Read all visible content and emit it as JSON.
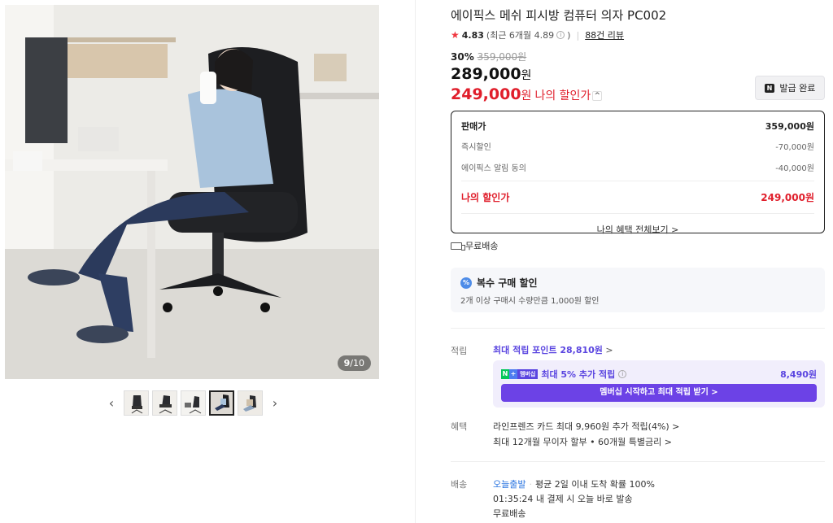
{
  "gallery": {
    "counter_current": "9",
    "counter_total": "/10",
    "prev_label": "‹",
    "next_label": "›"
  },
  "product": {
    "title": "에이픽스 메쉬 피시방 컴퓨터 의자 PC002",
    "rating": "4.83",
    "rating_recent": "(최근 6개월 4.89",
    "rating_recent_close": ")",
    "review_count": "88건 리뷰",
    "discount_rate": "30%",
    "original_price": "359,000원",
    "price": "289,000",
    "price_unit": "원",
    "my_price": "249,000",
    "my_price_unit": "원",
    "my_price_label": "나의 할인가",
    "coupon_button": "발급 완료",
    "coupon_badge": "N"
  },
  "breakdown": {
    "sale_label": "판매가",
    "sale_value": "359,000원",
    "instant_label": "즉시할인",
    "instant_value": "-70,000원",
    "alarm_label": "에이픽스 알림 동의",
    "alarm_value": "-40,000원",
    "mine_label": "나의 할인가",
    "mine_value": "249,000원",
    "all_benefits": "나의 혜택 전체보기 >"
  },
  "shipping_badge": "무료배송",
  "multi_buy": {
    "icon": "%",
    "title": "복수 구매 할인",
    "desc": "2개 이상 구매시 수량만큼 1,000원 할인"
  },
  "points": {
    "label": "적립",
    "max_points": "최대 적립 포인트 28,810원",
    "chev": " >",
    "badge_n": "N",
    "badge_plus": "+",
    "badge_member": "멤버십",
    "membership_text": "최대 5% 추가 적립",
    "membership_amount": "8,490원",
    "membership_cta": "멤버십 시작하고 최대 적립 받기 >"
  },
  "benefits": {
    "label": "혜택",
    "line1": "라인프렌즈 카드 최대 9,960원 추가 적립(4%) >",
    "line2": "최대 12개월 무이자 할부 • 60개월 특별금리 >"
  },
  "delivery": {
    "label": "배송",
    "today": "오늘출발",
    "stat": "평균 2일 이내 도착 확률 100%",
    "countdown": "01:35:24  내 결제 시 오늘 바로 발송",
    "free": "무료배송"
  },
  "colors": {
    "accent_red": "#e01e2b",
    "accent_purple": "#5a45e0",
    "accent_blue": "#2a74e0",
    "naver_green": "#03c75a"
  }
}
